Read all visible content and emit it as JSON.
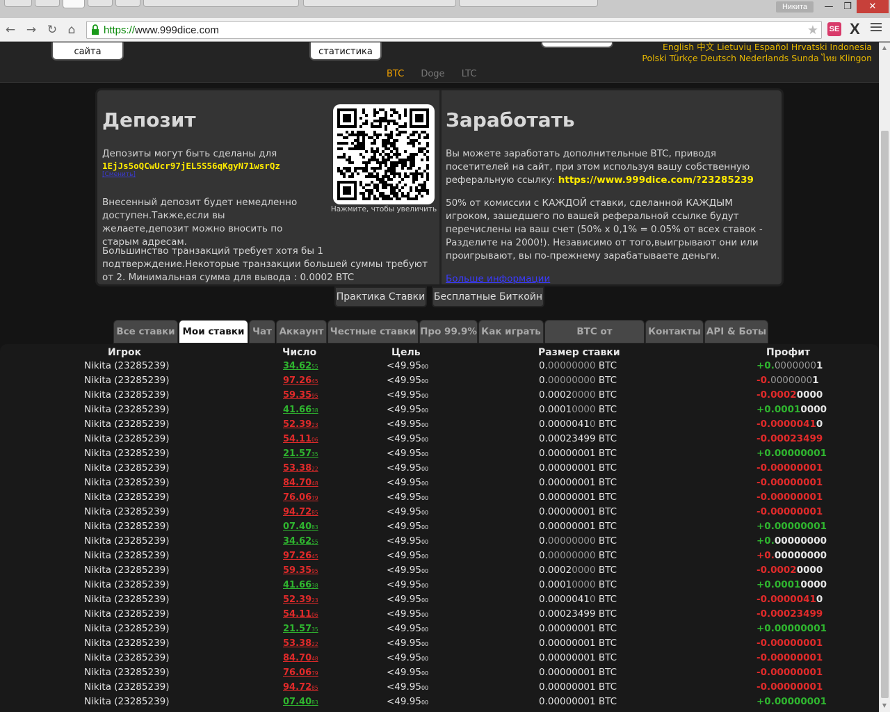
{
  "browser": {
    "user_name": "Никита",
    "url_scheme": "https://",
    "url_rest": "www.999dice.com",
    "ext_label": "SE",
    "ext_x": "X",
    "win_min": "—",
    "win_max": "❐",
    "win_close": "✕"
  },
  "header": {
    "btn_left": "сайта",
    "btn_stats": "статистика",
    "lang_line1": "English 中文 Lietuvių Español Hrvatski Indonesia",
    "lang_line2": "Polski Türkçe Deutsch Nederlands Sunda ไทย Klingon",
    "coins": [
      "BTC",
      "Doge",
      "LTC"
    ]
  },
  "deposit": {
    "title": "Депозит",
    "intro": "Депозиты могут быть сделаны для",
    "address": "1EjJs5oQCwUcr97jEL5S56qKgyN71wsrQz",
    "address_link": "[Сменить]",
    "p2": "Внесенный депозит будет немедленно доступен.Также,если вы желаете,депозит можно вносить по старым адресам.",
    "p3": "Большинство транзакций требует хотя бы 1 подтверждение.Некоторые транзакции большей суммы требуют от 2. Минимальная сумма для вывода : 0.0002 BTC",
    "qr_caption": "Нажмите, чтобы увеличить"
  },
  "earn": {
    "title": "Заработать",
    "p1": "Вы можете заработать дополнительные BTC, приводя посетителей на сайт, при этом используя вашу собственную реферальную ссылку: ",
    "ref_link": "https://www.999dice.com/?23285239",
    "p2": "50% от комиссии с КАЖДОЙ ставки, сделанной КАЖДЫМ игроком, зашедшего по вашей реферальной ссылке будут перечислены на ваш счет (50% x 0,1% = 0.05% от всех ставок - Разделите на 2000!). Независимо от того,выигрывают они или проигрывают, вы по-прежнему зарабатываете деньги.",
    "more_link": "Больше информации"
  },
  "sub_buttons": {
    "practice": "Практика Ставки",
    "free": "Бесплатные Биткойн"
  },
  "tabs": [
    {
      "label": "Все ставки",
      "active": false
    },
    {
      "label": "Мои ставки",
      "active": true
    },
    {
      "label": "Чат",
      "active": false
    },
    {
      "label": "Аккаунт",
      "active": false
    },
    {
      "label": "Честные ставки",
      "active": false
    },
    {
      "label": "Про 99.9%",
      "active": false
    },
    {
      "label": "Как играть",
      "active": false
    },
    {
      "label": "BTC от рефералов",
      "active": false
    },
    {
      "label": "Контакты",
      "active": false
    },
    {
      "label": "API & Боты",
      "active": false
    }
  ],
  "table": {
    "headers": {
      "player": "Игрок",
      "number": "Число",
      "target": "Цель",
      "size": "Размер ставки",
      "profit": "Профит"
    },
    "rows": [
      {
        "player": "Nikita (23285239)",
        "num_main": "34.62",
        "num_small": "55",
        "win": true,
        "target_main": "<49.95",
        "target_small": "00",
        "size_a": "0.",
        "size_b": "00000000",
        "size_c": "",
        "profit_a": "+0.",
        "profit_b": "0000000",
        "profit_c": "1",
        "pos": true
      },
      {
        "player": "Nikita (23285239)",
        "num_main": "97.26",
        "num_small": "45",
        "win": false,
        "target_main": "<49.95",
        "target_small": "00",
        "size_a": "0.",
        "size_b": "00000000",
        "size_c": "",
        "profit_a": "-0.",
        "profit_b": "0000000",
        "profit_c": "1",
        "pos": false
      },
      {
        "player": "Nikita (23285239)",
        "num_main": "59.35",
        "num_small": "95",
        "win": false,
        "target_main": "<49.95",
        "target_small": "00",
        "size_a": "0.0002",
        "size_b": "0000",
        "size_c": "",
        "profit_a": "-0.0002",
        "profit_b": "",
        "profit_c": "0000",
        "pos": false
      },
      {
        "player": "Nikita (23285239)",
        "num_main": "41.66",
        "num_small": "38",
        "win": true,
        "target_main": "<49.95",
        "target_small": "00",
        "size_a": "0.0001",
        "size_b": "0000",
        "size_c": "",
        "profit_a": "+0.0001",
        "profit_b": "",
        "profit_c": "0000",
        "pos": true
      },
      {
        "player": "Nikita (23285239)",
        "num_main": "52.39",
        "num_small": "23",
        "win": false,
        "target_main": "<49.95",
        "target_small": "00",
        "size_a": "0.0000041",
        "size_b": "0",
        "size_c": "",
        "profit_a": "-0.0000041",
        "profit_b": "",
        "profit_c": "0",
        "pos": false
      },
      {
        "player": "Nikita (23285239)",
        "num_main": "54.11",
        "num_small": "06",
        "win": false,
        "target_main": "<49.95",
        "target_small": "00",
        "size_a": "0.00023499",
        "size_b": "",
        "size_c": "",
        "profit_a": "-0.00023499",
        "profit_b": "",
        "profit_c": "",
        "pos": false
      },
      {
        "player": "Nikita (23285239)",
        "num_main": "21.57",
        "num_small": "35",
        "win": true,
        "target_main": "<49.95",
        "target_small": "00",
        "size_a": "0.00000001",
        "size_b": "",
        "size_c": "",
        "profit_a": "+0.00000001",
        "profit_b": "",
        "profit_c": "",
        "pos": true
      },
      {
        "player": "Nikita (23285239)",
        "num_main": "53.38",
        "num_small": "22",
        "win": false,
        "target_main": "<49.95",
        "target_small": "00",
        "size_a": "0.00000001",
        "size_b": "",
        "size_c": "",
        "profit_a": "-0.00000001",
        "profit_b": "",
        "profit_c": "",
        "pos": false
      },
      {
        "player": "Nikita (23285239)",
        "num_main": "84.70",
        "num_small": "48",
        "win": false,
        "target_main": "<49.95",
        "target_small": "00",
        "size_a": "0.00000001",
        "size_b": "",
        "size_c": "",
        "profit_a": "-0.00000001",
        "profit_b": "",
        "profit_c": "",
        "pos": false
      },
      {
        "player": "Nikita (23285239)",
        "num_main": "76.06",
        "num_small": "79",
        "win": false,
        "target_main": "<49.95",
        "target_small": "00",
        "size_a": "0.00000001",
        "size_b": "",
        "size_c": "",
        "profit_a": "-0.00000001",
        "profit_b": "",
        "profit_c": "",
        "pos": false
      },
      {
        "player": "Nikita (23285239)",
        "num_main": "94.72",
        "num_small": "85",
        "win": false,
        "target_main": "<49.95",
        "target_small": "00",
        "size_a": "0.00000001",
        "size_b": "",
        "size_c": "",
        "profit_a": "-0.00000001",
        "profit_b": "",
        "profit_c": "",
        "pos": false
      },
      {
        "player": "Nikita (23285239)",
        "num_main": "07.40",
        "num_small": "83",
        "win": true,
        "target_main": "<49.95",
        "target_small": "00",
        "size_a": "0.00000001",
        "size_b": "",
        "size_c": "",
        "profit_a": "+0.00000001",
        "profit_b": "",
        "profit_c": "",
        "pos": true
      },
      {
        "player": "Nikita (23285239)",
        "num_main": "34.62",
        "num_small": "55",
        "win": true,
        "target_main": "<49.95",
        "target_small": "00",
        "size_a": "0.",
        "size_b": "00000000",
        "size_c": "",
        "profit_a": "+0.",
        "profit_b": "",
        "profit_c": "00000000",
        "pos": true
      },
      {
        "player": "Nikita (23285239)",
        "num_main": "97.26",
        "num_small": "45",
        "win": false,
        "target_main": "<49.95",
        "target_small": "00",
        "size_a": "0.",
        "size_b": "00000000",
        "size_c": "",
        "profit_a": "+0.",
        "profit_b": "",
        "profit_c": "00000000",
        "pos": false
      },
      {
        "player": "Nikita (23285239)",
        "num_main": "59.35",
        "num_small": "95",
        "win": false,
        "target_main": "<49.95",
        "target_small": "00",
        "size_a": "0.0002",
        "size_b": "0000",
        "size_c": "",
        "profit_a": "-0.0002",
        "profit_b": "",
        "profit_c": "0000",
        "pos": false
      },
      {
        "player": "Nikita (23285239)",
        "num_main": "41.66",
        "num_small": "38",
        "win": true,
        "target_main": "<49.95",
        "target_small": "00",
        "size_a": "0.0001",
        "size_b": "0000",
        "size_c": "",
        "profit_a": "+0.0001",
        "profit_b": "",
        "profit_c": "0000",
        "pos": true
      },
      {
        "player": "Nikita (23285239)",
        "num_main": "52.39",
        "num_small": "23",
        "win": false,
        "target_main": "<49.95",
        "target_small": "00",
        "size_a": "0.0000041",
        "size_b": "0",
        "size_c": "",
        "profit_a": "-0.0000041",
        "profit_b": "",
        "profit_c": "0",
        "pos": false
      },
      {
        "player": "Nikita (23285239)",
        "num_main": "54.11",
        "num_small": "06",
        "win": false,
        "target_main": "<49.95",
        "target_small": "00",
        "size_a": "0.00023499",
        "size_b": "",
        "size_c": "",
        "profit_a": "-0.00023499",
        "profit_b": "",
        "profit_c": "",
        "pos": false
      },
      {
        "player": "Nikita (23285239)",
        "num_main": "21.57",
        "num_small": "35",
        "win": true,
        "target_main": "<49.95",
        "target_small": "00",
        "size_a": "0.00000001",
        "size_b": "",
        "size_c": "",
        "profit_a": "+0.00000001",
        "profit_b": "",
        "profit_c": "",
        "pos": true
      },
      {
        "player": "Nikita (23285239)",
        "num_main": "53.38",
        "num_small": "22",
        "win": false,
        "target_main": "<49.95",
        "target_small": "00",
        "size_a": "0.00000001",
        "size_b": "",
        "size_c": "",
        "profit_a": "-0.00000001",
        "profit_b": "",
        "profit_c": "",
        "pos": false
      },
      {
        "player": "Nikita (23285239)",
        "num_main": "84.70",
        "num_small": "48",
        "win": false,
        "target_main": "<49.95",
        "target_small": "00",
        "size_a": "0.00000001",
        "size_b": "",
        "size_c": "",
        "profit_a": "-0.00000001",
        "profit_b": "",
        "profit_c": "",
        "pos": false
      },
      {
        "player": "Nikita (23285239)",
        "num_main": "76.06",
        "num_small": "79",
        "win": false,
        "target_main": "<49.95",
        "target_small": "00",
        "size_a": "0.00000001",
        "size_b": "",
        "size_c": "",
        "profit_a": "-0.00000001",
        "profit_b": "",
        "profit_c": "",
        "pos": false
      },
      {
        "player": "Nikita (23285239)",
        "num_main": "94.72",
        "num_small": "85",
        "win": false,
        "target_main": "<49.95",
        "target_small": "00",
        "size_a": "0.00000001",
        "size_b": "",
        "size_c": "",
        "profit_a": "-0.00000001",
        "profit_b": "",
        "profit_c": "",
        "pos": false
      },
      {
        "player": "Nikita (23285239)",
        "num_main": "07.40",
        "num_small": "83",
        "win": true,
        "target_main": "<49.95",
        "target_small": "00",
        "size_a": "0.00000001",
        "size_b": "",
        "size_c": "",
        "profit_a": "+0.00000001",
        "profit_b": "",
        "profit_c": "",
        "pos": true
      }
    ],
    "currency": "BTC"
  },
  "colors": {
    "win": "#2fb52f",
    "loss": "#e02a2a",
    "accent": "#ffea00",
    "coin_active": "#f0a000"
  }
}
